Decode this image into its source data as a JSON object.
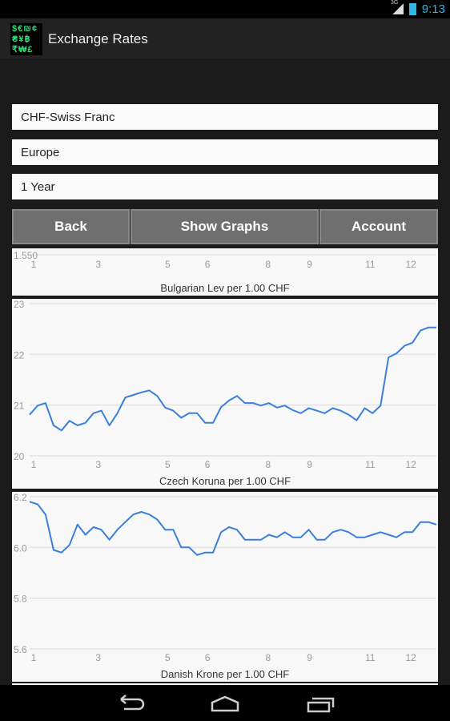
{
  "status_bar": {
    "time": "9:13",
    "network": "3G",
    "icons": [
      "signal-icon",
      "battery-charging-icon"
    ]
  },
  "app": {
    "title": "Exchange Rates",
    "logo_glyphs": "$€₪¢₴¥฿₹₩£"
  },
  "selectors": {
    "currency": "CHF-Swiss Franc",
    "region": "Europe",
    "period": "1 Year"
  },
  "buttons": {
    "back": "Back",
    "show_graphs": "Show Graphs",
    "account": "Account"
  },
  "colors": {
    "line": "#3a7fdc",
    "accent": "#33b5e5"
  },
  "chart_data": [
    {
      "type": "line",
      "title": "Bulgarian Lev per 1.00 CHF",
      "yticks": [
        "1.550"
      ],
      "xticks": [
        {
          "label": "1",
          "at": 0.5
        },
        {
          "label": "3",
          "at": 8.6
        },
        {
          "label": "5",
          "at": 17.3
        },
        {
          "label": "6",
          "at": 22.3
        },
        {
          "label": "8",
          "at": 29.9
        },
        {
          "label": "9",
          "at": 35.1
        },
        {
          "label": "11",
          "at": 42.7
        },
        {
          "label": "12",
          "at": 47.8
        }
      ],
      "values": []
    },
    {
      "type": "line",
      "title": "Czech Koruna per 1.00 CHF",
      "ylim": [
        20,
        23
      ],
      "yticks": [
        "20",
        "21",
        "22",
        "23"
      ],
      "xticks": [
        {
          "label": "1",
          "at": 0.5
        },
        {
          "label": "3",
          "at": 8.6
        },
        {
          "label": "5",
          "at": 17.3
        },
        {
          "label": "6",
          "at": 22.3
        },
        {
          "label": "8",
          "at": 29.9
        },
        {
          "label": "9",
          "at": 35.1
        },
        {
          "label": "11",
          "at": 42.7
        },
        {
          "label": "12",
          "at": 47.8
        }
      ],
      "values": [
        20.81,
        20.99,
        21.04,
        20.6,
        20.5,
        20.69,
        20.6,
        20.65,
        20.84,
        20.89,
        20.6,
        20.84,
        21.15,
        21.2,
        21.25,
        21.29,
        21.18,
        20.95,
        20.89,
        20.75,
        20.84,
        20.84,
        20.65,
        20.65,
        20.96,
        21.09,
        21.18,
        21.04,
        21.04,
        20.99,
        21.04,
        20.95,
        20.99,
        20.9,
        20.84,
        20.94,
        20.89,
        20.84,
        20.94,
        20.89,
        20.81,
        20.7,
        20.94,
        20.84,
        20.99,
        21.94,
        22.02,
        22.17,
        22.23,
        22.47,
        22.53,
        22.53
      ]
    },
    {
      "type": "line",
      "title": "Danish Krone per 1.00 CHF",
      "ylim": [
        5.6,
        6.2
      ],
      "yticks": [
        "5.6",
        "5.8",
        "6.0",
        "6.2"
      ],
      "xticks": [
        {
          "label": "1",
          "at": 0.5
        },
        {
          "label": "3",
          "at": 8.6
        },
        {
          "label": "5",
          "at": 17.3
        },
        {
          "label": "6",
          "at": 22.3
        },
        {
          "label": "8",
          "at": 29.9
        },
        {
          "label": "9",
          "at": 35.1
        },
        {
          "label": "11",
          "at": 42.7
        },
        {
          "label": "12",
          "at": 47.8
        }
      ],
      "values": [
        6.18,
        6.17,
        6.13,
        5.99,
        5.98,
        6.01,
        6.09,
        6.05,
        6.08,
        6.07,
        6.03,
        6.07,
        6.1,
        6.13,
        6.14,
        6.13,
        6.11,
        6.07,
        6.07,
        6.0,
        6.0,
        5.97,
        5.98,
        5.98,
        6.06,
        6.08,
        6.07,
        6.03,
        6.03,
        6.03,
        6.05,
        6.04,
        6.06,
        6.04,
        6.04,
        6.07,
        6.03,
        6.03,
        6.06,
        6.07,
        6.06,
        6.04,
        6.04,
        6.05,
        6.06,
        6.05,
        6.04,
        6.06,
        6.06,
        6.1,
        6.1,
        6.09
      ]
    }
  ]
}
